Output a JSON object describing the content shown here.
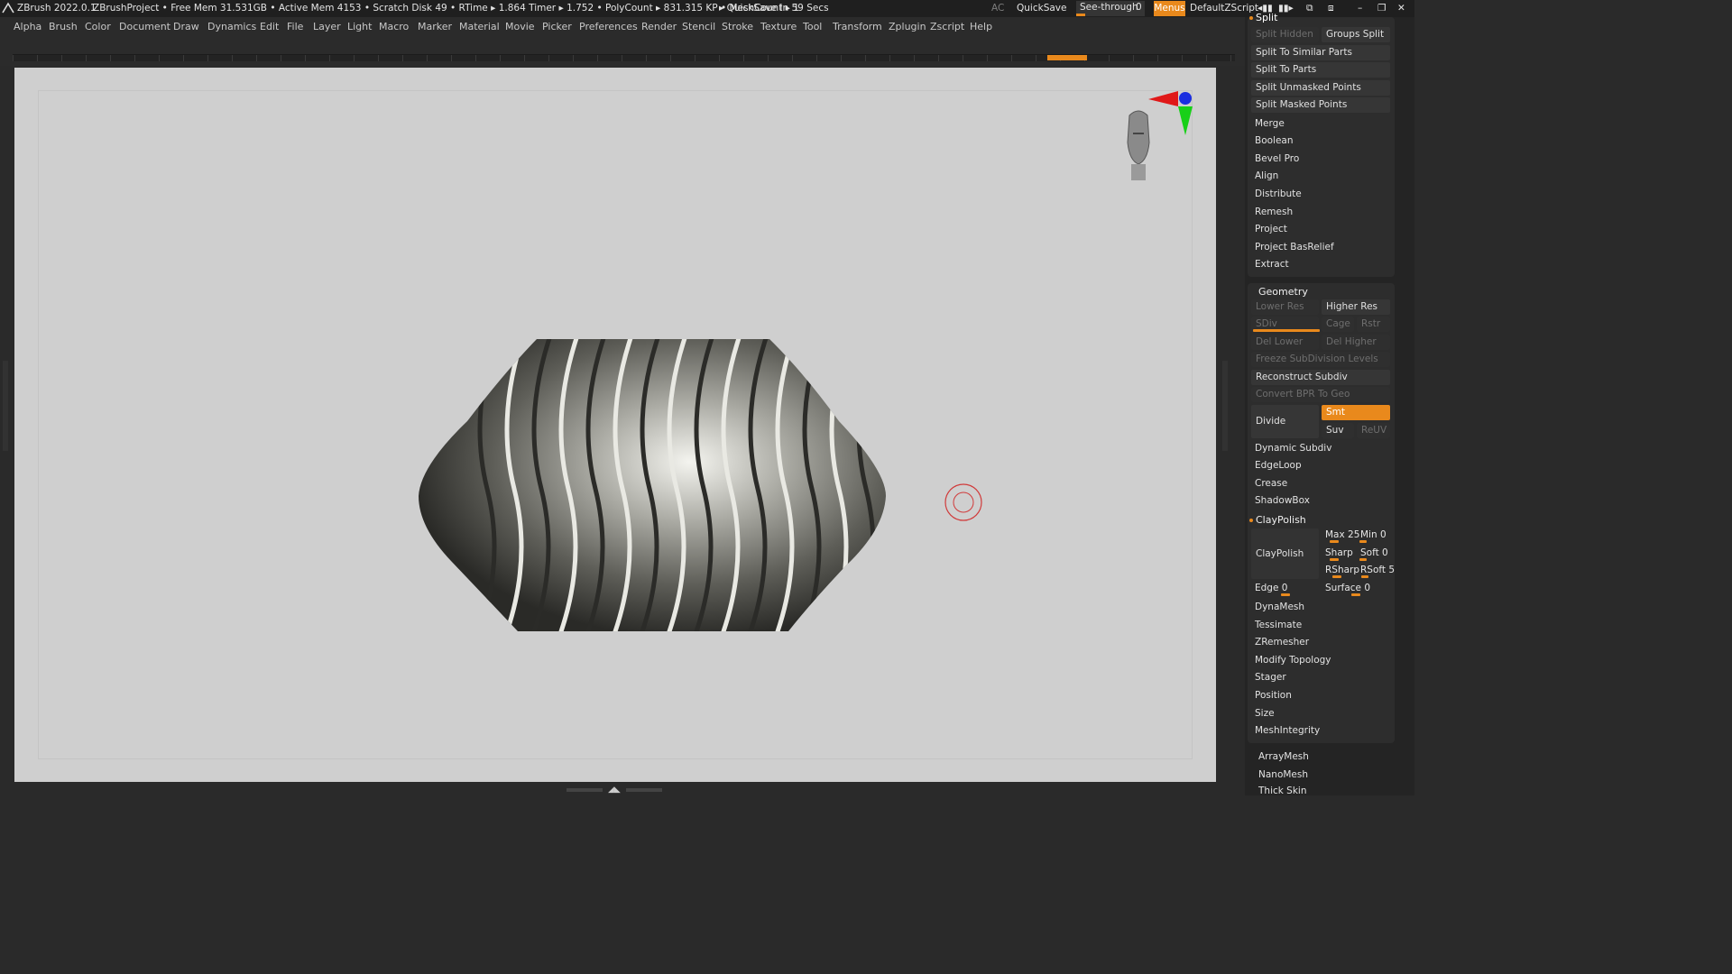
{
  "title_bar": {
    "app": "ZBrush 2022.0.1",
    "project": "ZBrushProject",
    "stats": ". • Free Mem 31.531GB • Active Mem 4153 • Scratch Disk 49 •  RTime ▸ 1.864 Timer ▸ 1.752 • PolyCount ▸ 831.315 KP  • MeshCount ▸ 1",
    "quicksave_timer": "▸ QuickSave In 59 Secs",
    "ac": "AC",
    "quicksave": "QuickSave",
    "see_through_label": "See-through",
    "see_through_value": "0",
    "menus": "Menus",
    "default_zscript": "DefaultZScript"
  },
  "menu": [
    "Alpha",
    "Brush",
    "Color",
    "Document",
    "Draw",
    "Dynamics",
    "Edit",
    "File",
    "Layer",
    "Light",
    "Macro",
    "Marker",
    "Material",
    "Movie",
    "Picker",
    "Preferences",
    "Render",
    "Stencil",
    "Stroke",
    "Texture",
    "Tool",
    "Transform",
    "Zplugin",
    "Zscript",
    "Help"
  ],
  "split_group": {
    "title": "Split",
    "split_hidden": "Split Hidden",
    "groups_split": "Groups Split",
    "split_similar": "Split To Similar Parts",
    "split_parts": "Split To Parts",
    "split_unmasked": "Split Unmasked Points",
    "split_masked": "Split Masked Points",
    "items": [
      "Merge",
      "Boolean",
      "Bevel Pro",
      "Align",
      "Distribute",
      "Remesh",
      "Project",
      "Project BasRelief",
      "Extract"
    ]
  },
  "geometry": {
    "title": "Geometry",
    "lower_res": "Lower Res",
    "higher_res": "Higher Res",
    "sdiv": "SDiv",
    "cage": "Cage",
    "rstr": "Rstr",
    "del_lower": "Del Lower",
    "del_higher": "Del Higher",
    "freeze": "Freeze SubDivision Levels",
    "reconstruct": "Reconstruct Subdiv",
    "convert_bpr": "Convert BPR To Geo",
    "divide": "Divide",
    "smt": "Smt",
    "suv": "Suv",
    "reuv": "ReUV",
    "dynamic_subdiv": "Dynamic Subdiv",
    "edgeloop": "EdgeLoop",
    "crease": "Crease",
    "shadowbox": "ShadowBox",
    "claypolish_title": "ClayPolish",
    "claypolish_btn": "ClayPolish",
    "max": "Max 25",
    "min": "Min 0",
    "sharp": "Sharp",
    "soft": "Soft 0",
    "rsharp": "RSharp",
    "rsoft": "RSoft 5",
    "edge": "Edge 0",
    "surface": "Surface 0",
    "items": [
      "DynaMesh",
      "Tessimate",
      "ZRemesher",
      "Modify Topology",
      "Stager",
      "Position",
      "Size",
      "MeshIntegrity"
    ]
  },
  "extra": [
    "ArrayMesh",
    "NanoMesh",
    "Thick Skin"
  ],
  "colors": {
    "accent": "#e9891c",
    "panel": "#2d2d2d",
    "canvas": "#cfcfcf"
  }
}
